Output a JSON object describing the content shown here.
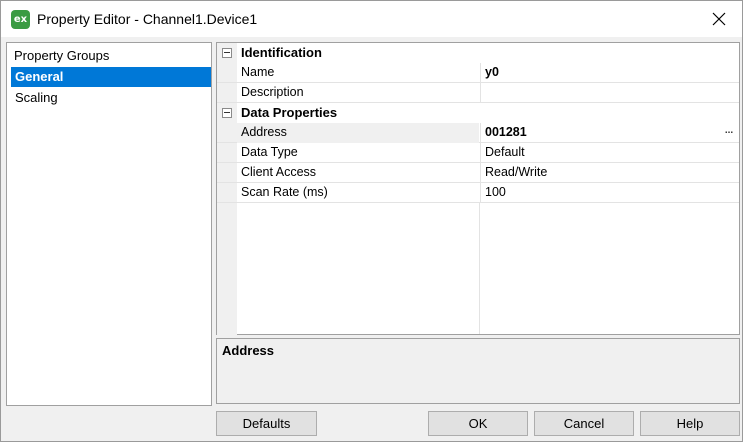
{
  "window": {
    "title": "Property Editor - Channel1.Device1",
    "app_icon_text": "ex"
  },
  "left_panel": {
    "header": "Property Groups",
    "items": [
      {
        "label": "General",
        "selected": true
      },
      {
        "label": "Scaling",
        "selected": false
      }
    ]
  },
  "grid": {
    "categories": [
      {
        "label": "Identification",
        "rows": [
          {
            "name": "Name",
            "value": "y0",
            "bold": true
          },
          {
            "name": "Description",
            "value": "",
            "bold": false
          }
        ]
      },
      {
        "label": "Data Properties",
        "rows": [
          {
            "name": "Address",
            "value": "001281",
            "bold": true,
            "selected": true,
            "has_ellipsis": true
          },
          {
            "name": "Data Type",
            "value": "Default",
            "bold": false
          },
          {
            "name": "Client Access",
            "value": "Read/Write",
            "bold": false
          },
          {
            "name": "Scan Rate (ms)",
            "value": "100",
            "bold": false
          }
        ]
      }
    ],
    "ellipsis_label": "..."
  },
  "description": {
    "title": "Address"
  },
  "buttons": {
    "defaults": "Defaults",
    "ok": "OK",
    "cancel": "Cancel",
    "help": "Help"
  },
  "colors": {
    "selection": "#0078d7",
    "app_icon": "#3a9b43"
  }
}
